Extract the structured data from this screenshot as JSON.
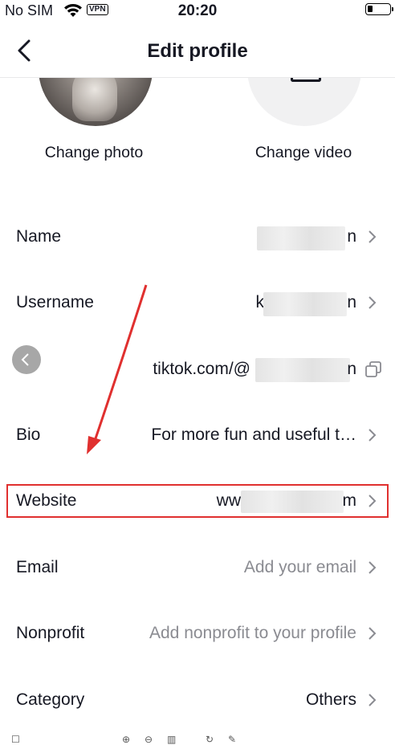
{
  "status_bar": {
    "carrier": "No SIM",
    "vpn": "VPN",
    "time": "20:20"
  },
  "nav": {
    "title": "Edit profile"
  },
  "media": {
    "change_photo": "Change photo",
    "change_video": "Change video"
  },
  "rows": {
    "name": {
      "label": "Name",
      "value_suffix": "n"
    },
    "username": {
      "label": "Username",
      "value_prefix": "k",
      "value_suffix": "n"
    },
    "link": {
      "value_prefix": "tiktok.com/@",
      "value_suffix": "n"
    },
    "bio": {
      "label": "Bio",
      "value": "For more fun and useful t…"
    },
    "website": {
      "label": "Website",
      "value_prefix": "ww",
      "value_suffix": "m"
    },
    "email": {
      "label": "Email",
      "placeholder": "Add your email"
    },
    "nonprofit": {
      "label": "Nonprofit",
      "placeholder": "Add nonprofit to your profile"
    },
    "category": {
      "label": "Category",
      "value": "Others"
    }
  },
  "colors": {
    "text": "#161823",
    "placeholder": "#8a8b91",
    "highlight": "#e0302f"
  }
}
